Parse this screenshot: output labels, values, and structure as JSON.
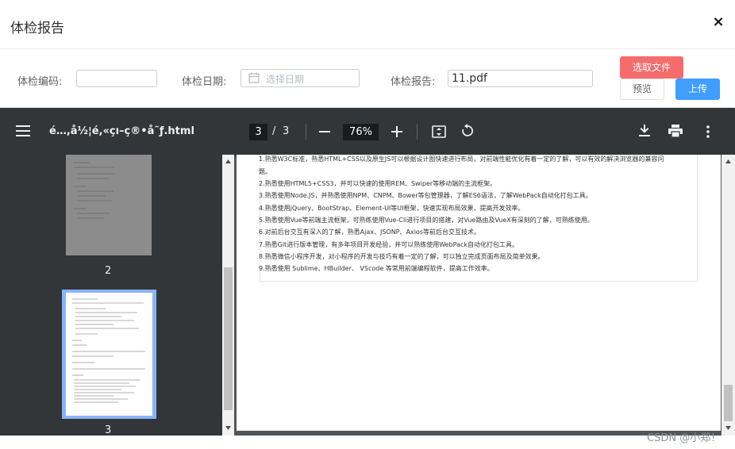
{
  "dialog": {
    "title": "体检报告",
    "close_symbol": "×"
  },
  "form": {
    "code_label": "体检编码:",
    "code_value": "",
    "date_label": "体检日期:",
    "date_placeholder": "选择日期",
    "report_label": "体检报告:",
    "file_name": "11.pdf",
    "pick_file_label": "选取文件",
    "preview_label": "预览",
    "upload_label": "上传"
  },
  "viewer": {
    "doc_title": "é…,å½¦é,«çı–ç®•å˜ƒ.html",
    "current_page": "3",
    "page_separator": "/",
    "total_pages": "3",
    "zoom": "76%",
    "thumbnails": [
      {
        "label": "2"
      },
      {
        "label": "3"
      }
    ],
    "lines": [
      "1.熟悉W3C标准，熟悉HTML+CSS以及原生JS可以根据设计图快速进行布局，对前端性能优化有着一定的了解，可以有效的解决浏览器的兼容问",
      "题。",
      "2.熟悉使用HTML5+CSS3，并可以快速的使用REM、Swiper等移动端的主流框架。",
      "3.熟悉使用Node.JS，并熟悉使用NPM、CNPM、Bower等包管理器，了解ES6语法，了解WebPack自动化打包工具。",
      "4.熟悉使用jQuery、BootStrap、Element-UI等UI框架，快速实现布局效果，提高开发效率。",
      "5.熟悉使用Vue等前端主流框架，可熟练使用Vue-Cli进行项目的搭建，对Vue路由及VueX有深刻的了解，可熟练使用。",
      "6.对前后台交互有深入的了解，熟悉Ajax、JSONP、Axios等前后台交互技术。",
      "7.熟悉Git进行版本管理，有多年项目开发经验，并可以熟练使用WebPack自动化打包工具。",
      "8.熟悉微信小程序开发，对小程序的开发与技巧有着一定的了解，可以独立完成页面布局及简单效果。",
      "9.熟悉使用 Sublime、HBuilder、 VScode 等常用前端编程软件，提高工作效率。"
    ]
  },
  "watermark": "CSDN @小郑！",
  "colors": {
    "toolbar": "#323639",
    "viewer_bg": "#525659",
    "pick_button": "#f56c6c",
    "upload_button": "#409eff",
    "thumb_selected": "#8ab4f8"
  }
}
